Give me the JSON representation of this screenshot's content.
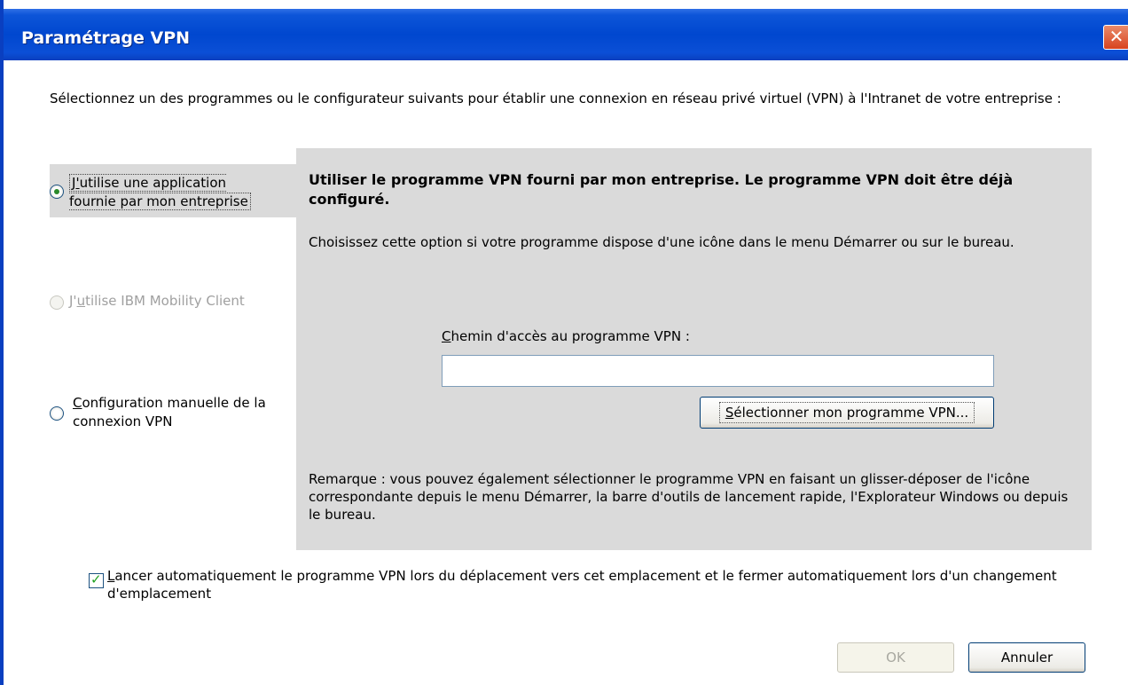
{
  "window": {
    "title": "Paramétrage VPN",
    "close_glyph": "✕"
  },
  "intro": "Sélectionnez un des programmes ou le configurateur suivants pour établir une connexion en réseau privé virtuel (VPN) à l'Intranet de votre entreprise :",
  "options": [
    {
      "first": "J",
      "accel": "'",
      "rest": "utilise une application",
      "line2": "fournie par mon entreprise",
      "selected": true,
      "enabled": true
    },
    {
      "first": "J'",
      "accel": "u",
      "rest": "tilise IBM Mobility Client",
      "selected": false,
      "enabled": false
    },
    {
      "first": "",
      "accel": "C",
      "rest": "onfiguration manuelle de la",
      "line2": "connexion VPN",
      "selected": false,
      "enabled": true
    }
  ],
  "panel": {
    "heading": "Utiliser le programme VPN fourni par mon entreprise. Le programme VPN doit être déjà configuré.",
    "description": "Choisissez cette option si votre programme dispose d'une icône dans le menu Démarrer ou sur le bureau.",
    "path_label_accel": "C",
    "path_label_rest": "hemin d'accès au programme VPN :",
    "path_value": "",
    "select_button_accel": "S",
    "select_button_rest": "électionner mon programme VPN...",
    "remark": "Remarque : vous pouvez également sélectionner le programme VPN en faisant un glisser-déposer de l'icône correspondante depuis le menu Démarrer, la barre d'outils de lancement rapide, l'Explorateur Windows ou depuis le bureau."
  },
  "auto_launch": {
    "checked": true,
    "accel": "L",
    "rest": "ancer automatiquement le programme VPN lors du déplacement vers cet emplacement et le fermer automatiquement lors d'un changement d'emplacement"
  },
  "buttons": {
    "ok": "OK",
    "cancel": "Annuler"
  }
}
